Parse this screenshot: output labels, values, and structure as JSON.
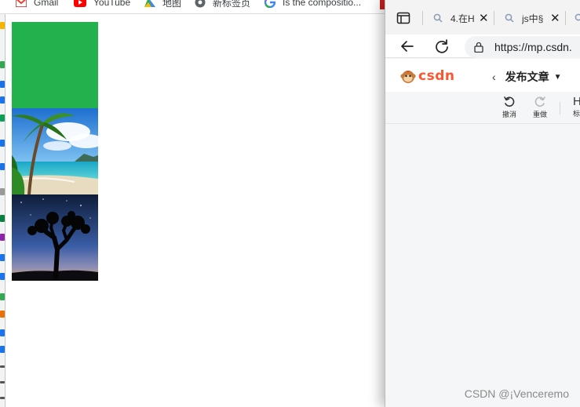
{
  "bookmarks": [
    {
      "label": "Gmail",
      "icon": "gmail-icon"
    },
    {
      "label": "YouTube",
      "icon": "youtube-icon"
    },
    {
      "label": "地图",
      "icon": "maps-icon"
    },
    {
      "label": "新标签页",
      "icon": "new-tab-icon"
    },
    {
      "label": "Is the compositio...",
      "icon": "google-icon"
    }
  ],
  "page_boxes": [
    {
      "kind": "solid",
      "color": "#23b14d"
    },
    {
      "kind": "image",
      "subject": "tropical beach with palm tree"
    },
    {
      "kind": "image",
      "subject": "joshua tree silhouette under starry sky"
    }
  ],
  "right_window": {
    "tabs": [
      {
        "label": "4.在H",
        "icon": "search-icon"
      },
      {
        "label": "js中§",
        "icon": "search-icon"
      }
    ],
    "url": "https://mp.csdn.",
    "csdn": {
      "logo_text": "csdn",
      "publish_title": "发布文章"
    },
    "tools": [
      {
        "label": "撤消",
        "icon": "undo-icon"
      },
      {
        "label": "重做",
        "icon": "redo-icon"
      }
    ],
    "partial_tool": {
      "glyph": "H",
      "label": "标"
    }
  },
  "watermark": "CSDN @¡Venceremo",
  "colors": {
    "accent_green": "#23b14d",
    "csdn_red": "#fc5531"
  }
}
